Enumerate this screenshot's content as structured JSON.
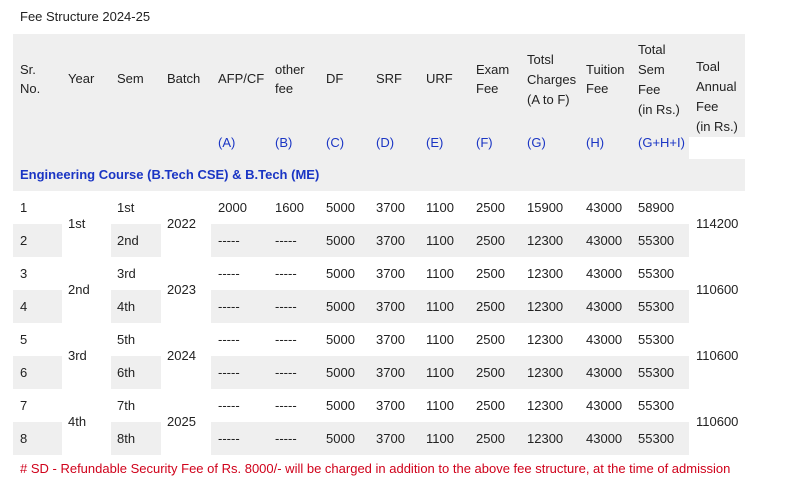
{
  "title": "Fee Structure 2024-25",
  "headers": {
    "sr": [
      "Sr.",
      "No."
    ],
    "year": "Year",
    "sem": "Sem",
    "batch": "Batch",
    "afp": "AFP/CF",
    "other": [
      "other",
      "fee"
    ],
    "df": "DF",
    "srf": "SRF",
    "urf": "URF",
    "exam": [
      "Exam",
      "Fee"
    ],
    "totsl": [
      "Totsl",
      "Charges",
      "(A to F)"
    ],
    "tuition": [
      "Tuition",
      "Fee"
    ],
    "totalsem": [
      "Total",
      "Sem",
      "Fee",
      "(in Rs.)"
    ],
    "toal": [
      "Toal",
      "Annual",
      "Fee",
      "(in Rs.)"
    ]
  },
  "codes": [
    "(A)",
    "(B)",
    "(C)",
    "(D)",
    "(E)",
    "(F)",
    "(G)",
    "(H)",
    "(G+H+I)"
  ],
  "section": "Engineering Course (B.Tech CSE) & B.Tech (ME)",
  "years": [
    {
      "label": "1st",
      "batch": "2022",
      "annual": "114200"
    },
    {
      "label": "2nd",
      "batch": "2023",
      "annual": "110600"
    },
    {
      "label": "3rd",
      "batch": "2024",
      "annual": "110600"
    },
    {
      "label": "4th",
      "batch": "2025",
      "annual": "110600"
    }
  ],
  "rows": [
    {
      "sr": "1",
      "sem": "1st",
      "afp": "2000",
      "other": "1600",
      "df": "5000",
      "srf": "3700",
      "urf": "1100",
      "exam": "2500",
      "totsl": "15900",
      "tuition": "43000",
      "total": "58900"
    },
    {
      "sr": "2",
      "sem": "2nd",
      "afp": "-----",
      "other": "-----",
      "df": "5000",
      "srf": "3700",
      "urf": "1100",
      "exam": "2500",
      "totsl": "12300",
      "tuition": "43000",
      "total": "55300"
    },
    {
      "sr": "3",
      "sem": "3rd",
      "afp": "-----",
      "other": "-----",
      "df": "5000",
      "srf": "3700",
      "urf": "1100",
      "exam": "2500",
      "totsl": "12300",
      "tuition": "43000",
      "total": "55300"
    },
    {
      "sr": "4",
      "sem": "4th",
      "afp": "-----",
      "other": "-----",
      "df": "5000",
      "srf": "3700",
      "urf": "1100",
      "exam": "2500",
      "totsl": "12300",
      "tuition": "43000",
      "total": "55300"
    },
    {
      "sr": "5",
      "sem": "5th",
      "afp": "-----",
      "other": "-----",
      "df": "5000",
      "srf": "3700",
      "urf": "1100",
      "exam": "2500",
      "totsl": "12300",
      "tuition": "43000",
      "total": "55300"
    },
    {
      "sr": "6",
      "sem": "6th",
      "afp": "-----",
      "other": "-----",
      "df": "5000",
      "srf": "3700",
      "urf": "1100",
      "exam": "2500",
      "totsl": "12300",
      "tuition": "43000",
      "total": "55300"
    },
    {
      "sr": "7",
      "sem": "7th",
      "afp": "-----",
      "other": "-----",
      "df": "5000",
      "srf": "3700",
      "urf": "1100",
      "exam": "2500",
      "totsl": "12300",
      "tuition": "43000",
      "total": "55300"
    },
    {
      "sr": "8",
      "sem": "8th",
      "afp": "-----",
      "other": "-----",
      "df": "5000",
      "srf": "3700",
      "urf": "1100",
      "exam": "2500",
      "totsl": "12300",
      "tuition": "43000",
      "total": "55300"
    }
  ],
  "note": "# SD - Refundable Security Fee of Rs. 8000/- will be charged in addition to the above fee structure, at the time of admission",
  "colors": {
    "header_bg": "#efefef",
    "link_blue": "#1a35c4",
    "note_red": "#d0021b"
  }
}
